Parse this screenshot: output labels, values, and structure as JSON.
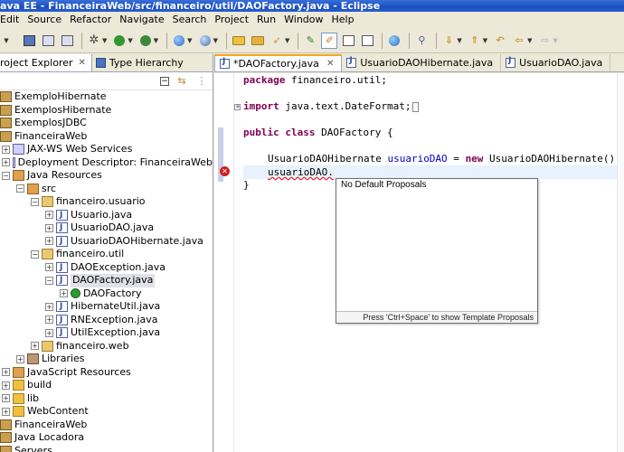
{
  "window": {
    "title": "ava EE - FinanceiraWeb/src/financeiro/util/DAOFactory.java - Eclipse"
  },
  "menu": [
    "Edit",
    "Source",
    "Refactor",
    "Navigate",
    "Search",
    "Project",
    "Run",
    "Window",
    "Help"
  ],
  "left_panel": {
    "tabs": [
      {
        "label": "roject Explorer",
        "close": "✕"
      },
      {
        "label": "Type Hierarchy"
      }
    ]
  },
  "tree": [
    {
      "label": "ExemploHibernate",
      "indent": 0,
      "icon": "project-icon",
      "expander": ""
    },
    {
      "label": "ExemplosHibernate",
      "indent": 0,
      "icon": "project-icon",
      "expander": ""
    },
    {
      "label": "ExemplosJDBC",
      "indent": 0,
      "icon": "project-icon",
      "expander": ""
    },
    {
      "label": "FinanceiraWeb",
      "indent": 0,
      "icon": "project-icon",
      "expander": ""
    },
    {
      "label": "JAX-WS Web Services",
      "indent": 1,
      "icon": "webservice-icon",
      "expander": "+"
    },
    {
      "label": "Deployment Descriptor: FinanceiraWeb",
      "indent": 1,
      "icon": "descriptor-icon",
      "expander": "+"
    },
    {
      "label": "Java Resources",
      "indent": 1,
      "icon": "java-resources-icon",
      "expander": "−"
    },
    {
      "label": "src",
      "indent": 2,
      "icon": "source-folder-icon",
      "expander": "−"
    },
    {
      "label": "financeiro.usuario",
      "indent": 3,
      "icon": "package-icon",
      "expander": "−"
    },
    {
      "label": "Usuario.java",
      "indent": 4,
      "icon": "java-file-icon",
      "expander": "+"
    },
    {
      "label": "UsuarioDAO.java",
      "indent": 4,
      "icon": "java-file-icon",
      "expander": "+"
    },
    {
      "label": "UsuarioDAOHibernate.java",
      "indent": 4,
      "icon": "java-file-icon",
      "expander": "+"
    },
    {
      "label": "financeiro.util",
      "indent": 3,
      "icon": "package-icon",
      "expander": "−"
    },
    {
      "label": "DAOException.java",
      "indent": 4,
      "icon": "java-file-icon",
      "expander": "+"
    },
    {
      "label": "DAOFactory.java",
      "indent": 4,
      "icon": "java-file-icon",
      "expander": "−",
      "selected": true
    },
    {
      "label": "DAOFactory",
      "indent": 5,
      "icon": "class-icon",
      "expander": "+"
    },
    {
      "label": "HibernateUtil.java",
      "indent": 4,
      "icon": "java-file-icon",
      "expander": "+"
    },
    {
      "label": "RNException.java",
      "indent": 4,
      "icon": "java-file-icon",
      "expander": "+"
    },
    {
      "label": "UtilException.java",
      "indent": 4,
      "icon": "java-file-icon",
      "expander": "+"
    },
    {
      "label": "financeiro.web",
      "indent": 3,
      "icon": "package-icon",
      "expander": "+"
    },
    {
      "label": "Libraries",
      "indent": 2,
      "icon": "library-icon",
      "expander": "+"
    },
    {
      "label": "JavaScript Resources",
      "indent": 1,
      "icon": "js-resources-icon",
      "expander": "+"
    },
    {
      "label": "build",
      "indent": 1,
      "icon": "folder-icon",
      "expander": "+"
    },
    {
      "label": "lib",
      "indent": 1,
      "icon": "folder-icon",
      "expander": "+"
    },
    {
      "label": "WebContent",
      "indent": 1,
      "icon": "folder-icon",
      "expander": "+"
    },
    {
      "label": "FinanceiraWeb",
      "indent": 0,
      "icon": "project-icon",
      "expander": ""
    },
    {
      "label": "Java Locadora",
      "indent": 0,
      "icon": "project-icon",
      "expander": ""
    },
    {
      "label": "Servers",
      "indent": 0,
      "icon": "project-icon",
      "expander": ""
    }
  ],
  "editor": {
    "tabs": [
      {
        "label": "*DAOFactory.java",
        "active": true,
        "close": "✕"
      },
      {
        "label": "UsuarioDAOHibernate.java",
        "active": false
      },
      {
        "label": "UsuarioDAO.java",
        "active": false
      }
    ],
    "code": {
      "package_kw": "package",
      "package_name": " financeiro.util;",
      "import_kw": "import",
      "import_name": " java.text.DateFormat;",
      "public_kw": "public",
      "class_kw": "class",
      "class_name": " DAOFactory {",
      "decl_type": "UsuarioDAOHibernate ",
      "decl_var": "usuarioDAO",
      "decl_eq": " = ",
      "new_kw": "new",
      "decl_rest": " UsuarioDAOHibernate()",
      "current_line": "usuarioDAO.",
      "close_brace": "}"
    }
  },
  "popup": {
    "item": "No Default Proposals",
    "status": "Press 'Ctrl+Space' to show Template Proposals"
  }
}
